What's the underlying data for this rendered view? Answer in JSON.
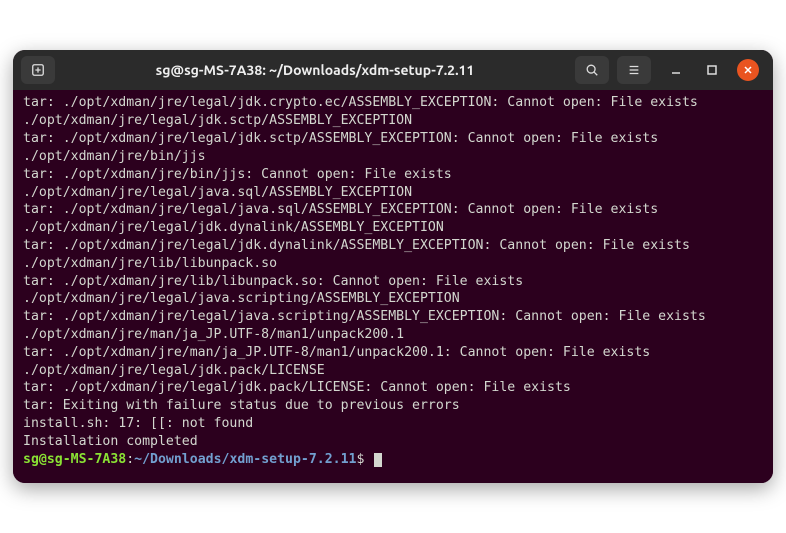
{
  "titlebar": {
    "title": "sg@sg-MS-7A38: ~/Downloads/xdm-setup-7.2.11"
  },
  "terminal": {
    "lines": [
      "tar: ./opt/xdman/jre/legal/jdk.crypto.ec/ASSEMBLY_EXCEPTION: Cannot open: File exists",
      "./opt/xdman/jre/legal/jdk.sctp/ASSEMBLY_EXCEPTION",
      "tar: ./opt/xdman/jre/legal/jdk.sctp/ASSEMBLY_EXCEPTION: Cannot open: File exists",
      "./opt/xdman/jre/bin/jjs",
      "tar: ./opt/xdman/jre/bin/jjs: Cannot open: File exists",
      "./opt/xdman/jre/legal/java.sql/ASSEMBLY_EXCEPTION",
      "tar: ./opt/xdman/jre/legal/java.sql/ASSEMBLY_EXCEPTION: Cannot open: File exists",
      "./opt/xdman/jre/legal/jdk.dynalink/ASSEMBLY_EXCEPTION",
      "tar: ./opt/xdman/jre/legal/jdk.dynalink/ASSEMBLY_EXCEPTION: Cannot open: File exists",
      "./opt/xdman/jre/lib/libunpack.so",
      "tar: ./opt/xdman/jre/lib/libunpack.so: Cannot open: File exists",
      "./opt/xdman/jre/legal/java.scripting/ASSEMBLY_EXCEPTION",
      "tar: ./opt/xdman/jre/legal/java.scripting/ASSEMBLY_EXCEPTION: Cannot open: File exists",
      "./opt/xdman/jre/man/ja_JP.UTF-8/man1/unpack200.1",
      "tar: ./opt/xdman/jre/man/ja_JP.UTF-8/man1/unpack200.1: Cannot open: File exists",
      "./opt/xdman/jre/legal/jdk.pack/LICENSE",
      "tar: ./opt/xdman/jre/legal/jdk.pack/LICENSE: Cannot open: File exists",
      "tar: Exiting with failure status due to previous errors",
      "install.sh: 17: [[: not found",
      "Installation completed"
    ],
    "prompt": {
      "user": "sg@sg-MS-7A38",
      "colon": ":",
      "path": "~/Downloads/xdm-setup-7.2.11",
      "dollar": "$"
    }
  }
}
